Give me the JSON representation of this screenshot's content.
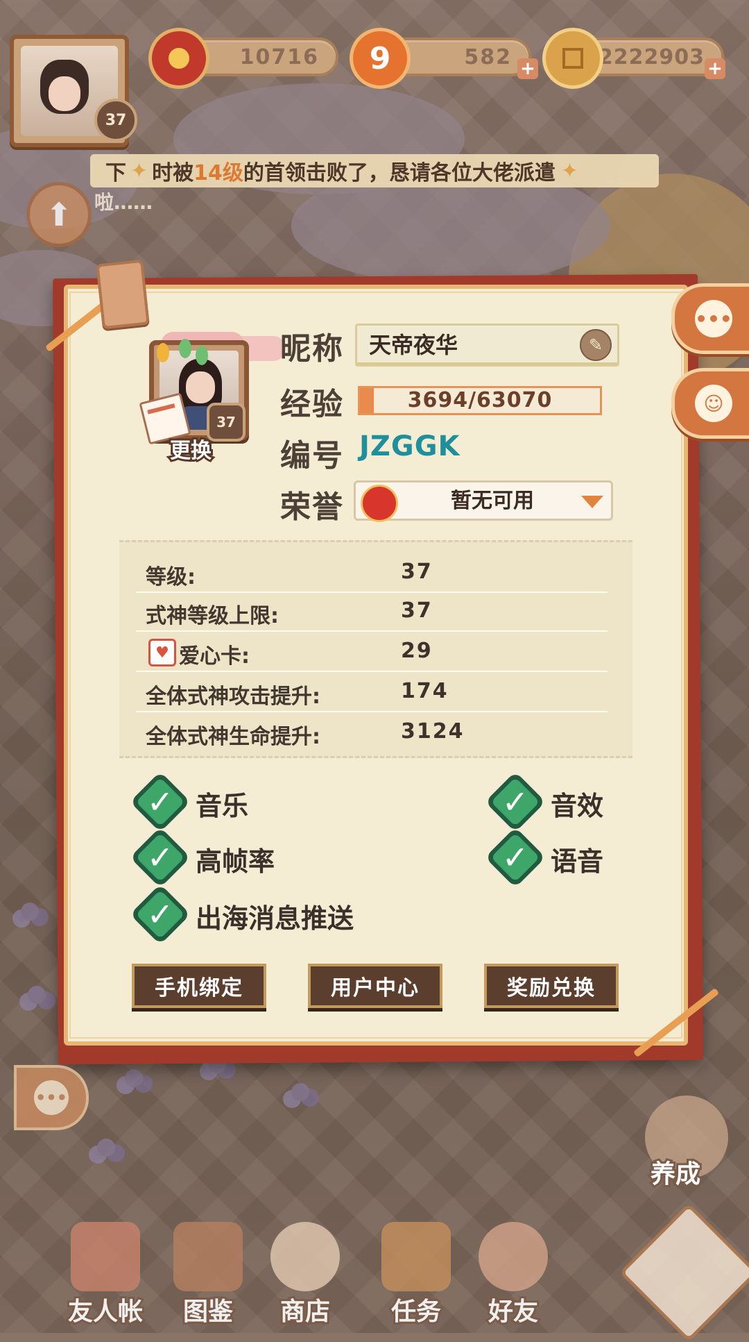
{
  "topbar": {
    "player_level": "37",
    "resource1_value": "10716",
    "resource2_value": "582",
    "resource3_value": "2222903",
    "plus_glyph": "+"
  },
  "news": {
    "text_prefix": "下",
    "text_a": "时被",
    "text_highlight": "14级",
    "text_b": "的首领击败了，恳请各位大佬派遣",
    "line2": "啦……"
  },
  "profile": {
    "avatar_level": "37",
    "change_label": "更换",
    "nickname_label": "昵称",
    "nickname_value": "天帝夜华",
    "exp_label": "经验",
    "exp_value": "3694/63070",
    "exp_progress": 0.0586,
    "id_label": "编号",
    "id_value": "JZGGK",
    "honor_label": "荣誉",
    "honor_value": "暂无可用"
  },
  "stats": [
    {
      "label": "等级:",
      "value": "37"
    },
    {
      "label": "式神等级上限:",
      "value": "37"
    },
    {
      "label": "爱心卡:",
      "value": "29"
    },
    {
      "label": "全体式神攻击提升:",
      "value": "174"
    },
    {
      "label": "全体式神生命提升:",
      "value": "3124"
    }
  ],
  "settings": {
    "music": "音乐",
    "sound_effects": "音效",
    "high_framerate": "高帧率",
    "voice": "语音",
    "push": "出海消息推送",
    "check_glyph": "✓"
  },
  "buttons": {
    "bind_phone": "手机绑定",
    "user_center": "用户中心",
    "redeem": "奖励兑换"
  },
  "bottom_nav": {
    "friend_book": "友人帐",
    "atlas": "图鉴",
    "shop": "商店",
    "tasks": "任务",
    "friends": "好友",
    "raise": "养成"
  },
  "colors": {
    "accent_orange": "#e88b4c",
    "id_teal": "#1f8f9c",
    "check_green": "#3fa66a",
    "panel_red": "#a23a2c"
  }
}
